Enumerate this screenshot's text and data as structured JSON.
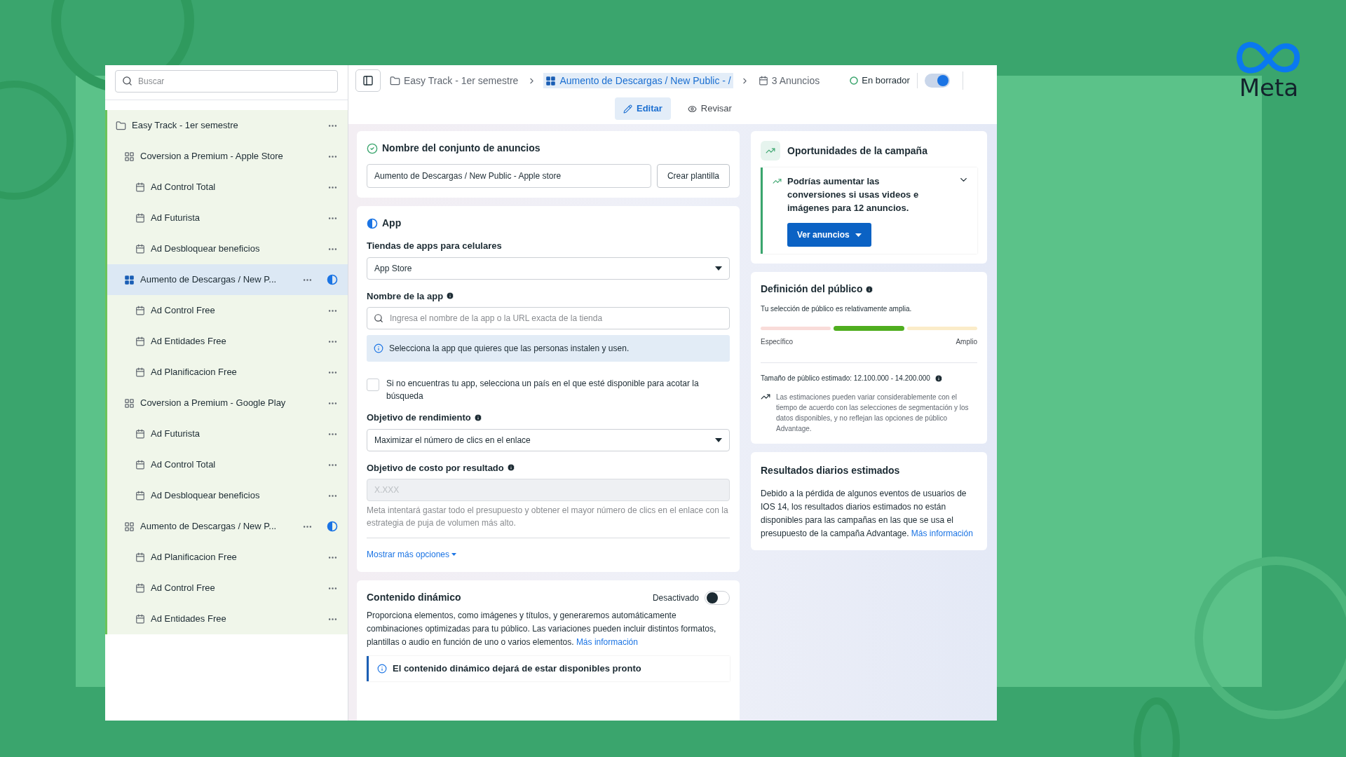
{
  "sidebar": {
    "search": {
      "placeholder": "Buscar"
    },
    "tree": [
      {
        "label": "Easy Track - 1er semestre",
        "kind": "folder",
        "selected": false,
        "incomplete": false,
        "children": [
          {
            "label": "Coversion a Premium - Apple Store",
            "kind": "adset",
            "selected": false,
            "incomplete": false,
            "children": [
              {
                "label": "Ad Control Total",
                "kind": "ad",
                "selected": false,
                "incomplete": false
              },
              {
                "label": "Ad Futurista",
                "kind": "ad",
                "selected": false,
                "incomplete": false
              },
              {
                "label": "Ad Desbloquear beneficios",
                "kind": "ad",
                "selected": false,
                "incomplete": false
              }
            ]
          },
          {
            "label": "Aumento de Descargas / New P...",
            "kind": "adset",
            "selected": true,
            "incomplete": true,
            "children": [
              {
                "label": "Ad Control Free",
                "kind": "ad",
                "selected": false,
                "incomplete": false
              },
              {
                "label": "Ad Entidades Free",
                "kind": "ad",
                "selected": false,
                "incomplete": false
              },
              {
                "label": "Ad Planificacion Free",
                "kind": "ad",
                "selected": false,
                "incomplete": false
              }
            ]
          },
          {
            "label": "Coversion a Premium - Google Play",
            "kind": "adset",
            "selected": false,
            "incomplete": false,
            "children": [
              {
                "label": "Ad Futurista",
                "kind": "ad",
                "selected": false,
                "incomplete": false
              },
              {
                "label": "Ad Control Total",
                "kind": "ad",
                "selected": false,
                "incomplete": false
              },
              {
                "label": "Ad Desbloquear beneficios",
                "kind": "ad",
                "selected": false,
                "incomplete": false
              }
            ]
          },
          {
            "label": "Aumento de Descargas / New P...",
            "kind": "adset",
            "selected": false,
            "incomplete": true,
            "children": [
              {
                "label": "Ad Planificacion Free",
                "kind": "ad",
                "selected": false,
                "incomplete": false
              },
              {
                "label": "Ad Control Free",
                "kind": "ad",
                "selected": false,
                "incomplete": false
              },
              {
                "label": "Ad Entidades Free",
                "kind": "ad",
                "selected": false,
                "incomplete": false
              }
            ]
          }
        ]
      }
    ]
  },
  "toolbar": {
    "breadcrumbs": [
      {
        "label": "Easy Track - 1er semestre",
        "kind": "folder",
        "selected": false
      },
      {
        "label": "Aumento de Descargas / New Public - /",
        "kind": "adset",
        "selected": true
      },
      {
        "label": "3 Anuncios",
        "kind": "ad",
        "selected": false
      }
    ],
    "status": "En borrador",
    "toggle_on": true,
    "tabs": [
      {
        "label": "Editar",
        "kind": "edit",
        "selected": true
      },
      {
        "label": "Revisar",
        "kind": "review",
        "selected": false
      }
    ]
  },
  "adset_name": {
    "title": "Nombre del conjunto de anuncios",
    "value": "Aumento de Descargas / New Public - Apple store",
    "button": "Crear plantilla"
  },
  "app": {
    "title": "App",
    "store_label": "Tiendas de apps para celulares",
    "store_value": "App Store",
    "app_name_label": "Nombre de la app",
    "app_name_placeholder": "Ingresa el nombre de la app o la URL exacta de la tienda",
    "info": "Selecciona la app que quieres que las personas instalen y usen.",
    "country_checkbox": {
      "label": "Si no encuentras tu app, selecciona un país en el que esté disponible para acotar la búsqueda",
      "checked": false
    },
    "performance_label": "Objetivo de rendimiento",
    "performance_value": "Maximizar el número de clics en el enlace",
    "cost_label": "Objetivo de costo por resultado",
    "cost_placeholder": "X.XXX",
    "cost_help": "Meta intentará gastar todo el presupuesto y obtener el mayor número de clics en el enlace con la estrategia de puja de volumen más alto.",
    "more_options": "Mostrar más opciones"
  },
  "dynamic": {
    "title": "Contenido dinámico",
    "toggle_label": "Desactivado",
    "on": false,
    "description": "Proporciona elementos, como imágenes y títulos, y generaremos automáticamente combinaciones optimizadas para tu público. Las variaciones pueden incluir distintos formatos, plantillas o audio en función de uno o varios elementos.",
    "link": "Más información",
    "notice": "El contenido dinámico dejará de estar disponibles pronto"
  },
  "opportunities": {
    "title": "Oportunidades de la campaña",
    "tip": "Podrías aumentar las conversiones si usas videos e imágenes para 12 anuncios.",
    "button": "Ver anuncios"
  },
  "audience": {
    "title": "Definición del público",
    "summary": "Tu selección de público es relativamente amplia.",
    "segments": [
      {
        "color": "#f9dcd9",
        "selected": false
      },
      {
        "color": "#4fae1f",
        "selected": true
      },
      {
        "color": "#fbecc9",
        "selected": false
      }
    ],
    "min_label": "Específico",
    "max_label": "Amplio",
    "size": "Tamaño de público estimado: 12.100.000 - 14.200.000",
    "note": "Las estimaciones pueden variar considerablemente con el tiempo de acuerdo con las selecciones de segmentación y los datos disponibles, y no reflejan las opciones de público Advantage."
  },
  "daily_results": {
    "title": "Resultados diarios estimados",
    "text": "Debido a la pérdida de algunos eventos de usuarios de IOS 14, los resultados diarios estimados no están disponibles para las campañas en las que se usa el presupuesto de la campaña Advantage.",
    "link": "Más información"
  },
  "brand": {
    "logo_text": "Meta"
  }
}
